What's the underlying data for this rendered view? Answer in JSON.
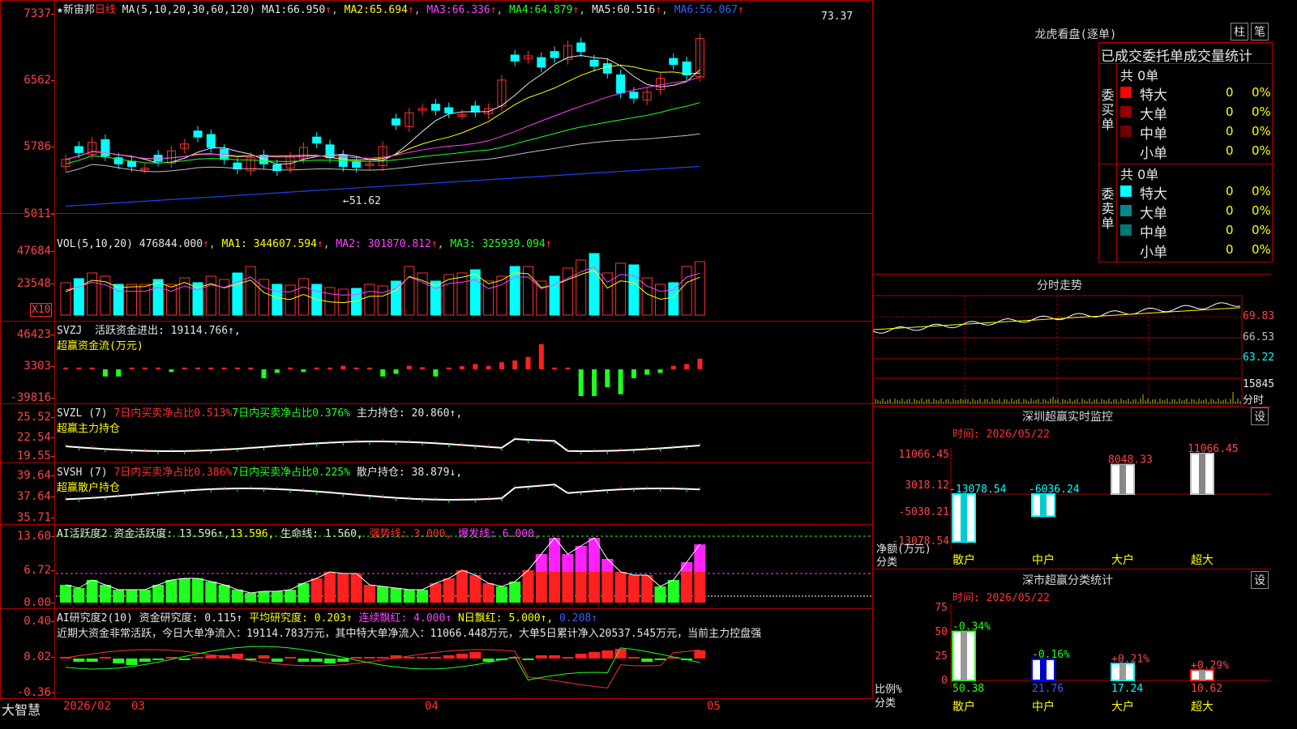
{
  "stock": {
    "name": "★新宙邦",
    "period": "日线"
  },
  "main": {
    "ma_label": "MA(5,10,20,30,60,120)",
    "ma1_label": "MA1:",
    "ma1": "66.950",
    "ma2_label": "MA2:",
    "ma2": "65.694",
    "ma3_label": "MA3:",
    "ma3": "66.336",
    "ma4_label": "MA4:",
    "ma4": "64.879",
    "ma5_label": "MA5:",
    "ma5": "60.516",
    "ma6_label": "MA6:",
    "ma6": "56.067",
    "arrow": "↑",
    "y_ticks": [
      "7337",
      "6562",
      "5786",
      "5011"
    ],
    "high_label": "73.37",
    "low_label": "51.62"
  },
  "vol": {
    "label": "VOL(5,10,20)",
    "value": "476844.000",
    "ma1_label": "MA1:",
    "ma1": "344607.594",
    "ma2_label": "MA2:",
    "ma2": "301870.812",
    "ma3_label": "MA3:",
    "ma3": "325939.094",
    "y_ticks": [
      "47684",
      "23548"
    ],
    "unit": "X10"
  },
  "svzj": {
    "label": "SVZJ",
    "text": "活跃资金进出: 19114.766↑,",
    "subtitle": "超赢资金流(万元)",
    "y_ticks": [
      "46423",
      "3303",
      "-39816"
    ]
  },
  "svzl": {
    "label": "SVZL (7)",
    "part1": "7日内买卖净占比0.513%",
    "part2": "7日内买卖净占比0.376%",
    "part3": "主力持仓: 20.860↑,",
    "subtitle": "超赢主力持仓",
    "y_ticks": [
      "25.52",
      "22.54",
      "19.55"
    ]
  },
  "svsh": {
    "label": "SVSH (7)",
    "part1": "7日内买卖净占比0.386%",
    "part2": "7日内买卖净占比0.225%",
    "part3": "散户持仓: 38.879↓,",
    "subtitle": "超赢散户持仓",
    "y_ticks": [
      "39.64",
      "37.64",
      "35.71"
    ]
  },
  "ai1": {
    "label": "AI活跃度2",
    "part1": "资金活跃度: 13.596↑,",
    "part2": "13.596,",
    "part3": "生命线: 1.560,",
    "part4": "强势线: 3.000,",
    "part5": "爆发线: 6.000,",
    "y_ticks": [
      "13.60",
      "6.72",
      "0.00"
    ]
  },
  "ai2": {
    "label": "AI研究度2(10)",
    "part1": "资金研究度: 0.115↑",
    "part2": "平均研究度: 0.203↑",
    "part3": "连续飘红: 4.000↑",
    "part4": "N日飘红: 5.000↑,",
    "part5": "0.208↑",
    "summary": "近期大资金非常活跃，今日大单净流入：19114.783万元，其中特大单净流入：11066.448万元，大单5日累计净入20537.545万元，当前主力控盘强",
    "y_ticks": [
      "0.40",
      "0.02",
      "-0.36"
    ]
  },
  "bottom": {
    "brand": "大智慧",
    "dates": [
      "2026/02",
      "03",
      "04",
      "05"
    ]
  },
  "right": {
    "lhb_title": "龙虎看盘(逐单)",
    "btn1": "柱",
    "btn2": "笔",
    "tabs": "已成交委托单成交量统计",
    "buy_label": "委买单",
    "sell_label": "委卖单",
    "buy_total": "共 0单",
    "sell_total": "共 0单",
    "buy_rows": [
      {
        "name": "特大",
        "v": "0",
        "p": "0%",
        "color": "#ff0000"
      },
      {
        "name": "大单",
        "v": "0",
        "p": "0%",
        "color": "#900000"
      },
      {
        "name": "中单",
        "v": "0",
        "p": "0%",
        "color": "#700000"
      },
      {
        "name": "小单",
        "v": "0",
        "p": "0%",
        "color": ""
      }
    ],
    "sell_rows": [
      {
        "name": "特大",
        "v": "0",
        "p": "0%",
        "color": "#00ffff"
      },
      {
        "name": "大单",
        "v": "0",
        "p": "0%",
        "color": "#008888"
      },
      {
        "name": "中单",
        "v": "0",
        "p": "0%",
        "color": "#007777"
      },
      {
        "name": "小单",
        "v": "0",
        "p": "0%",
        "color": ""
      }
    ],
    "fs_title": "分时走势",
    "fs_ticks": [
      "69.83",
      "66.53",
      "63.22"
    ],
    "fs_vol": "15845",
    "fs_vol_unit": "分时",
    "sz_title": "深圳超赢实时监控",
    "sz_time": "时间: 2026/05/22",
    "sz_ticks": [
      "11066.45",
      "3018.12",
      "-5030.21",
      "-13078.54"
    ],
    "sz_bars": [
      {
        "cat": "散户",
        "value": -13078.54,
        "label": "-13078.54"
      },
      {
        "cat": "中户",
        "value": -6036.24,
        "label": "-6036.24"
      },
      {
        "cat": "大户",
        "value": 8048.33,
        "label": "8048.33"
      },
      {
        "cat": "超大",
        "value": 11066.45,
        "label": "11066.45"
      }
    ],
    "sz_ylab1": "净额(万元)",
    "sz_ylab2": "分类",
    "sh_title": "深市超赢分类统计",
    "sh_time": "时间: 2026/05/22",
    "sh_ticks": [
      "75",
      "50",
      "25",
      "0"
    ],
    "sh_bars": [
      {
        "cat": "散户",
        "value": 50.38,
        "chg": "-0.34%"
      },
      {
        "cat": "中户",
        "value": 21.76,
        "chg": "-0.16%"
      },
      {
        "cat": "大户",
        "value": 17.24,
        "chg": "+0.21%"
      },
      {
        "cat": "超大",
        "value": 10.62,
        "chg": "+0.29%"
      }
    ],
    "sh_ylab1": "比例%",
    "sh_ylab2": "分类",
    "settings": "设"
  },
  "chart_data": {
    "type": "candlestick",
    "ylim": [
      50.11,
      73.37
    ],
    "close": [
      56.4,
      57.2,
      58.4,
      56.8,
      55.9,
      55.6,
      55.4,
      56.2,
      57.4,
      58.2,
      59.0,
      57.8,
      56.4,
      55.3,
      56.6,
      55.9,
      55.1,
      56.7,
      57.8,
      58.3,
      56.6,
      55.6,
      55.5,
      55.9,
      57.9,
      60.4,
      61.8,
      62.3,
      62.1,
      61.8,
      61.6,
      61.9,
      62.3,
      65.6,
      67.8,
      68.4,
      67.1,
      68.2,
      69.6,
      68.9,
      67.2,
      66.4,
      64.1,
      63.5,
      64.2,
      65.8,
      67.4,
      66.2,
      70.4
    ]
  }
}
